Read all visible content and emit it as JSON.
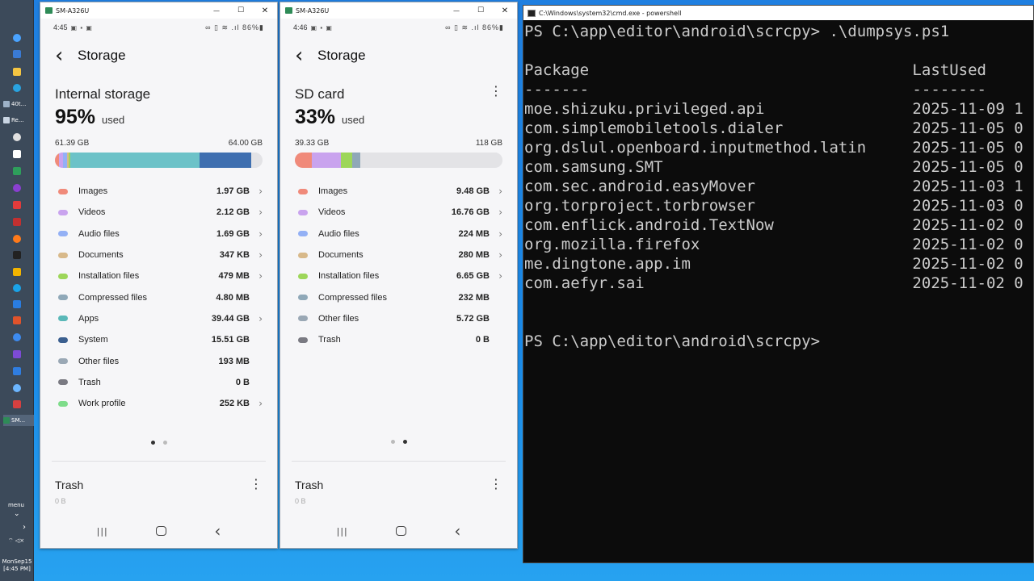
{
  "taskbar": {
    "items": [
      {
        "label": "",
        "color": "#4aa3ff"
      },
      {
        "label": "",
        "color": "#3a7bd5"
      },
      {
        "label": "",
        "color": "#f4c542"
      },
      {
        "label": "",
        "color": "#29a3e0"
      },
      {
        "label": "40t...",
        "color": "#9db2c8"
      },
      {
        "label": "Re...",
        "color": "#c9d5e3"
      },
      {
        "label": "",
        "color": "#e0e0e0"
      },
      {
        "label": "",
        "color": "#ffffff"
      },
      {
        "label": "",
        "color": "#2e9e5b"
      },
      {
        "label": "",
        "color": "#8a3fd1"
      },
      {
        "label": "",
        "color": "#e23b3b"
      },
      {
        "label": "",
        "color": "#c23030"
      },
      {
        "label": "",
        "color": "#ff7a1a"
      },
      {
        "label": "",
        "color": "#222222"
      },
      {
        "label": "",
        "color": "#f2b400"
      },
      {
        "label": "",
        "color": "#1aa3e8"
      },
      {
        "label": "",
        "color": "#2a7de1"
      },
      {
        "label": "",
        "color": "#e0532b"
      },
      {
        "label": "",
        "color": "#3d8bf0"
      },
      {
        "label": "",
        "color": "#7d4bd6"
      },
      {
        "label": "",
        "color": "#2f7de0"
      },
      {
        "label": "",
        "color": "#6cb6ff"
      },
      {
        "label": "",
        "color": "#d64040"
      },
      {
        "label": "SM...",
        "color": "#2e8b57"
      }
    ],
    "menu_label": "menu",
    "clock": {
      "day": "MonSep15",
      "time": "[4:45 PM]"
    }
  },
  "phones": [
    {
      "window_title": "SM-A326U",
      "status_time": "4:45",
      "status_icons": "▣ ▪ ▣",
      "status_right": "∞ ▯ ≋ .ıl 86%▮",
      "appbar_title": "Storage",
      "storage_name": "Internal storage",
      "percent": "95%",
      "used_label": "used",
      "used_size": "61.39 GB",
      "total_size": "64.00 GB",
      "has_kebab": false,
      "bar": [
        {
          "color": "#f08a7a",
          "frac": 0.02
        },
        {
          "color": "#c9a3ee",
          "frac": 0.02
        },
        {
          "color": "#93b0f5",
          "frac": 0.02
        },
        {
          "color": "#d8b98a",
          "frac": 0.005
        },
        {
          "color": "#9dd65a",
          "frac": 0.01
        },
        {
          "color": "#6cc2c8",
          "frac": 0.62
        },
        {
          "color": "#3f6fb0",
          "frac": 0.25
        },
        {
          "color": "#e3e3e6",
          "frac": 0.035
        }
      ],
      "categories": [
        {
          "label": "Images",
          "value": "1.97 GB",
          "color": "#f08a7a",
          "chevron": true
        },
        {
          "label": "Videos",
          "value": "2.12 GB",
          "color": "#c9a3ee",
          "chevron": true
        },
        {
          "label": "Audio files",
          "value": "1.69 GB",
          "color": "#93b0f5",
          "chevron": true
        },
        {
          "label": "Documents",
          "value": "347 KB",
          "color": "#d8b98a",
          "chevron": true
        },
        {
          "label": "Installation files",
          "value": "479 MB",
          "color": "#9dd65a",
          "chevron": true
        },
        {
          "label": "Compressed files",
          "value": "4.80 MB",
          "color": "#8fa8b8",
          "chevron": false
        },
        {
          "label": "Apps",
          "value": "39.44 GB",
          "color": "#5ab8b8",
          "chevron": true
        },
        {
          "label": "System",
          "value": "15.51 GB",
          "color": "#3b5f8f",
          "chevron": false
        },
        {
          "label": "Other files",
          "value": "193 MB",
          "color": "#9aa8b5",
          "chevron": false
        },
        {
          "label": "Trash",
          "value": "0 B",
          "color": "#7a7a82",
          "chevron": false
        },
        {
          "label": "Work profile",
          "value": "252 KB",
          "color": "#7edc8a",
          "chevron": true
        }
      ],
      "active_dot": 0,
      "trash_title": "Trash",
      "trash_sub": "0 B"
    },
    {
      "window_title": "SM-A326U",
      "status_time": "4:46",
      "status_icons": "▣ ▪ ▣",
      "status_right": "∞ ▯ ≋ .ıl 86%▮",
      "appbar_title": "Storage",
      "storage_name": "SD card",
      "percent": "33%",
      "used_label": "used",
      "used_size": "39.33 GB",
      "total_size": "118 GB",
      "has_kebab": true,
      "bar": [
        {
          "color": "#f08a7a",
          "frac": 0.08
        },
        {
          "color": "#c9a3ee",
          "frac": 0.14
        },
        {
          "color": "#9dd65a",
          "frac": 0.055
        },
        {
          "color": "#8fa8b8",
          "frac": 0.04
        },
        {
          "color": "#e3e3e6",
          "frac": 0.685
        }
      ],
      "categories": [
        {
          "label": "Images",
          "value": "9.48 GB",
          "color": "#f08a7a",
          "chevron": true
        },
        {
          "label": "Videos",
          "value": "16.76 GB",
          "color": "#c9a3ee",
          "chevron": true
        },
        {
          "label": "Audio files",
          "value": "224 MB",
          "color": "#93b0f5",
          "chevron": true
        },
        {
          "label": "Documents",
          "value": "280 MB",
          "color": "#d8b98a",
          "chevron": true
        },
        {
          "label": "Installation files",
          "value": "6.65 GB",
          "color": "#9dd65a",
          "chevron": true
        },
        {
          "label": "Compressed files",
          "value": "232 MB",
          "color": "#8fa8b8",
          "chevron": false
        },
        {
          "label": "Other files",
          "value": "5.72 GB",
          "color": "#9aa8b5",
          "chevron": false
        },
        {
          "label": "Trash",
          "value": "0 B",
          "color": "#7a7a82",
          "chevron": false
        }
      ],
      "active_dot": 1,
      "trash_title": "Trash",
      "trash_sub": "0 B"
    }
  ],
  "console": {
    "window_title": "C:\\Windows\\system32\\cmd.exe - powershell",
    "lines": [
      "PS C:\\app\\editor\\android\\scrcpy> .\\dumpsys.ps1",
      "",
      "Package                                   LastUsed",
      "-------                                   --------",
      "moe.shizuku.privileged.api                2025-11-09 1",
      "com.simplemobiletools.dialer              2025-11-05 0",
      "org.dslul.openboard.inputmethod.latin     2025-11-05 0",
      "com.samsung.SMT                           2025-11-05 0",
      "com.sec.android.easyMover                 2025-11-03 1",
      "org.torproject.torbrowser                 2025-11-03 0",
      "com.enflick.android.TextNow               2025-11-02 0",
      "org.mozilla.firefox                       2025-11-02 0",
      "me.dingtone.app.im                        2025-11-02 0",
      "com.aefyr.sai                             2025-11-02 0",
      "",
      "",
      "PS C:\\app\\editor\\android\\scrcpy>"
    ]
  }
}
